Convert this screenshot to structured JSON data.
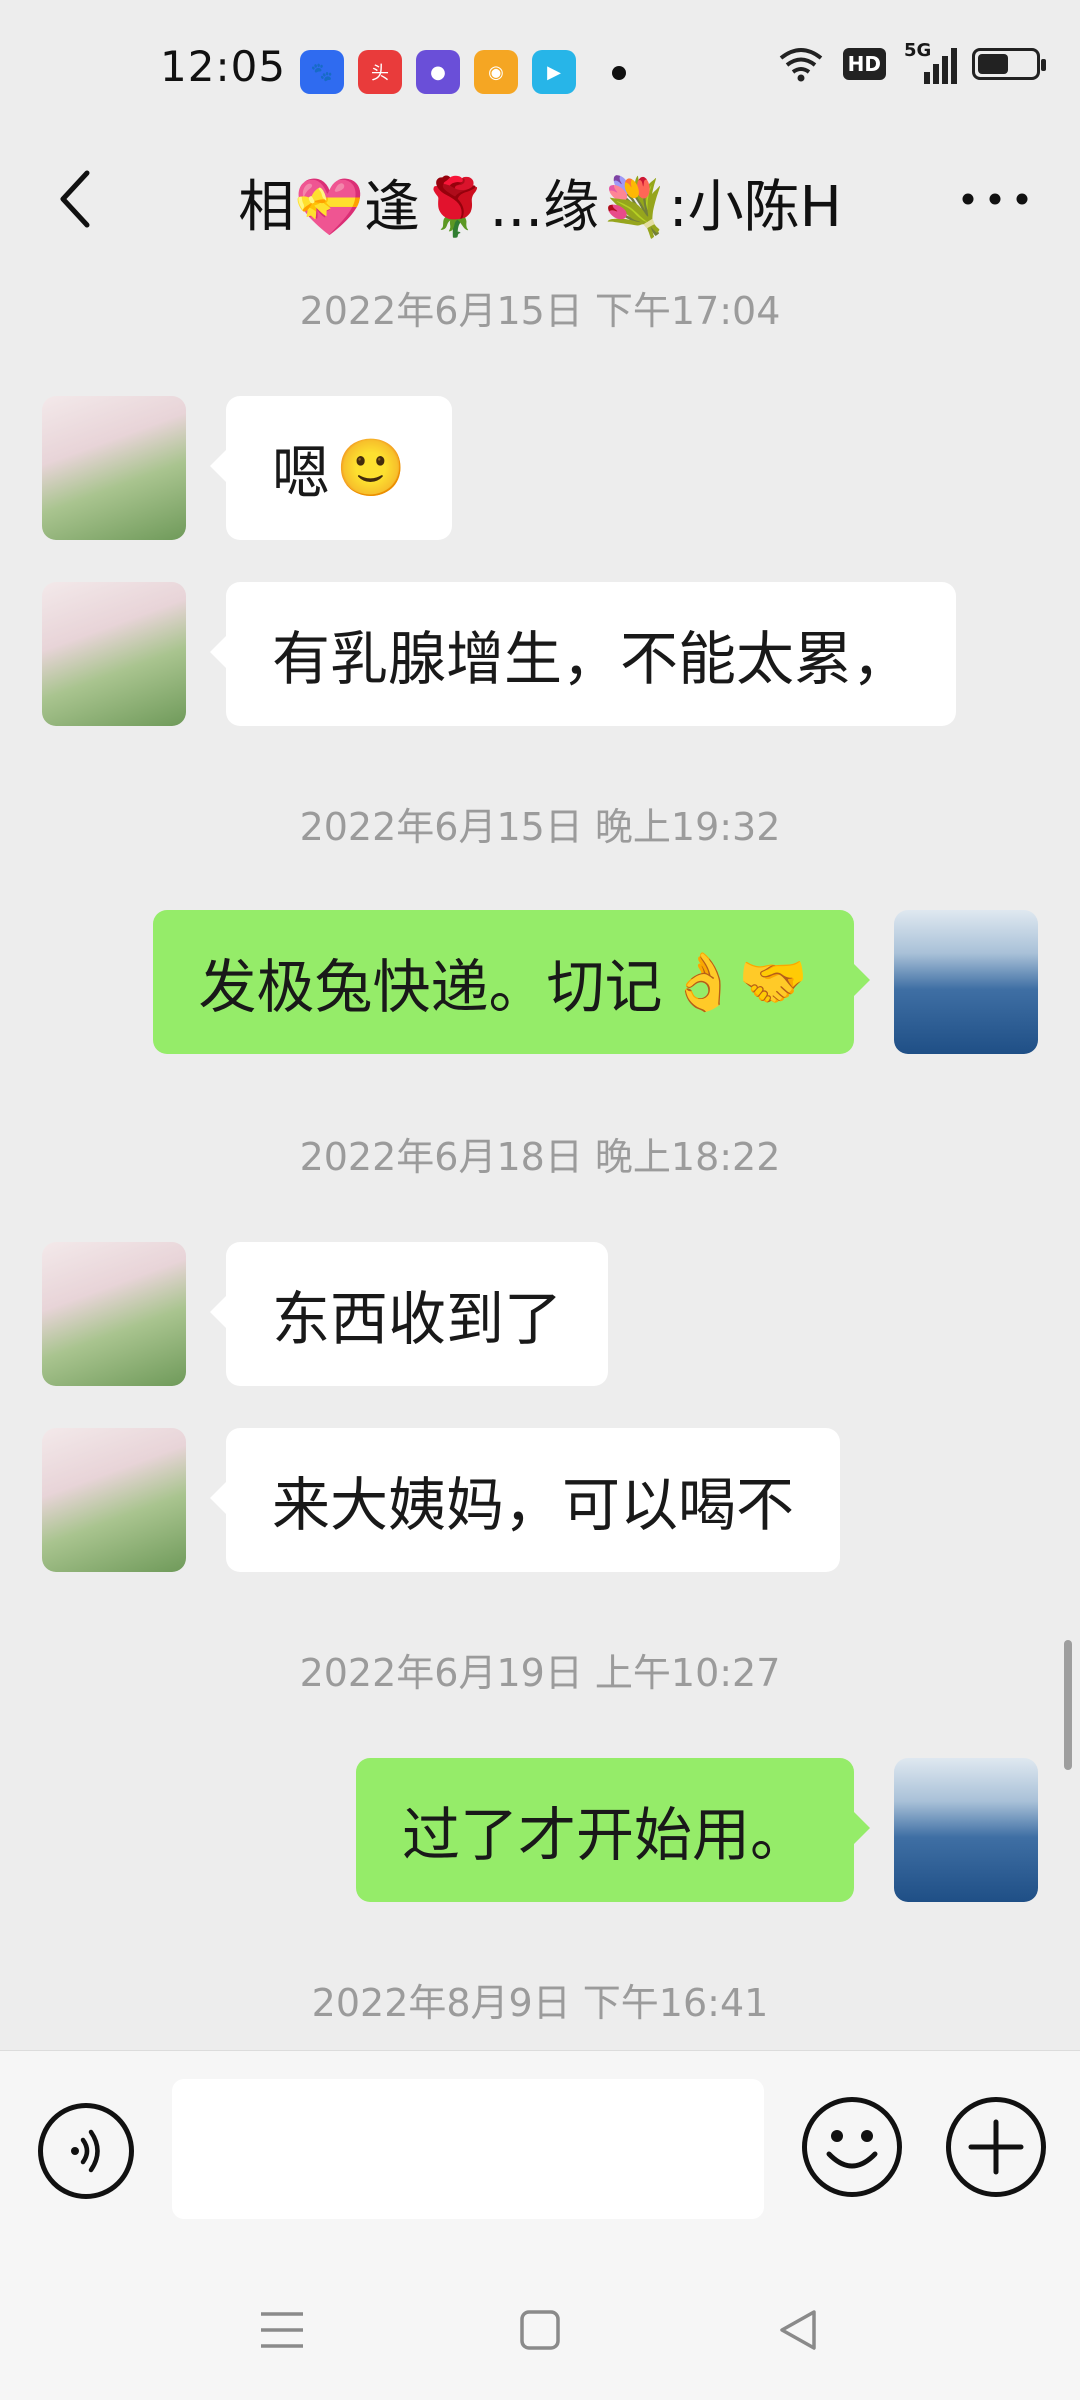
{
  "status_bar": {
    "time": "12:05",
    "network": "5G",
    "hd": "HD",
    "notifications": [
      {
        "icon": "baidu-icon",
        "color": "#2f6bf0"
      },
      {
        "icon": "toutiao-icon",
        "color": "#e93b3b"
      },
      {
        "icon": "circle-app-icon",
        "color": "#6a4fd8"
      },
      {
        "icon": "weibo-icon",
        "color": "#f5a623"
      },
      {
        "icon": "video-app-icon",
        "color": "#27b5e8"
      }
    ]
  },
  "header": {
    "title": "相💝逢🌹...缘💐:小陈H"
  },
  "messages": [
    {
      "type": "time",
      "text": "2022年6月15日 下午17:04"
    },
    {
      "type": "in",
      "text": "嗯",
      "emoji": "🙂"
    },
    {
      "type": "in",
      "text": "有乳腺增生，不能太累，"
    },
    {
      "type": "time",
      "text": "2022年6月15日 晚上19:32"
    },
    {
      "type": "out",
      "text": "发极兔快递。切记",
      "emoji": "👌🤝"
    },
    {
      "type": "time",
      "text": "2022年6月18日 晚上18:22"
    },
    {
      "type": "in",
      "text": "东西收到了"
    },
    {
      "type": "in",
      "text": "来大姨妈，可以喝不"
    },
    {
      "type": "time",
      "text": "2022年6月19日 上午10:27"
    },
    {
      "type": "out",
      "text": "过了才开始用。"
    },
    {
      "type": "time",
      "text": "2022年8月9日 下午16:41"
    }
  ],
  "input": {
    "value": "",
    "placeholder": ""
  },
  "colors": {
    "outgoing_bubble": "#95ec69",
    "incoming_bubble": "#ffffff",
    "background": "#ededed"
  }
}
